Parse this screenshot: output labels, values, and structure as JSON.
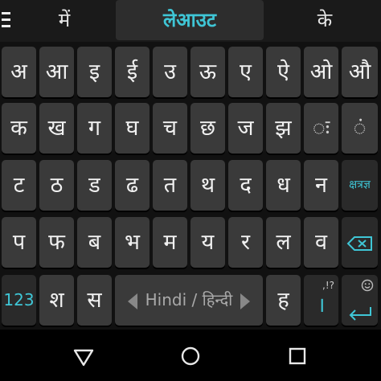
{
  "suggestions": {
    "left": "में",
    "center": "लेआउट",
    "right": "के"
  },
  "rows": [
    [
      "अ",
      "आ",
      "इ",
      "ई",
      "उ",
      "ऊ",
      "ए",
      "ऐ",
      "ओ",
      "औ"
    ],
    [
      "क",
      "ख",
      "ग",
      "घ",
      "च",
      "छ",
      "ज",
      "झ",
      "ः",
      "ं"
    ],
    [
      "ट",
      "ठ",
      "ड",
      "ढ",
      "त",
      "थ",
      "द",
      "ध",
      "न",
      "क्षत्रज्ञ"
    ],
    [
      "प",
      "फ",
      "ब",
      "भ",
      "म",
      "य",
      "र",
      "ल",
      "व"
    ]
  ],
  "bottom_row": {
    "numbers_label": "123",
    "key1": "श",
    "key2": "स",
    "space_label": "Hindi / हिन्दी",
    "key3": "ह",
    "punct_hint": ",!?",
    "punct_main": "।"
  },
  "icons": {
    "menu": "menu-icon",
    "backspace": "backspace-icon",
    "enter": "enter-icon",
    "emoji": "emoji-icon",
    "back": "nav-back-icon",
    "home": "nav-home-icon",
    "recents": "nav-recents-icon"
  },
  "colors": {
    "accent": "#3fc6d6",
    "key_bg": "#3a3a3a",
    "keyboard_bg": "#111111"
  }
}
